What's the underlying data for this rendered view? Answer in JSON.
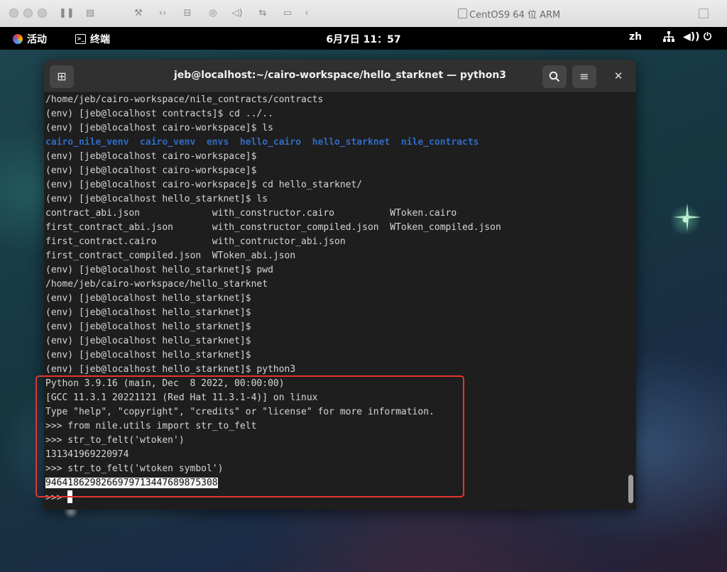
{
  "mac_window": {
    "title": "CentOS9 64 位 ARM",
    "toolbar_icons": [
      "pause-icon",
      "snapshot-icon",
      "settings-wrench-icon",
      "code-icon",
      "disk-icon",
      "camera-icon",
      "volume-icon",
      "usb-icon",
      "folder-share-icon",
      "back-chevron-icon"
    ]
  },
  "gnome_panel": {
    "activities": "活动",
    "app_name": "终端",
    "clock": "6月7日  11：57",
    "input_method": "zh",
    "tray_icons": [
      "network-icon",
      "volume-icon",
      "power-icon"
    ]
  },
  "terminal": {
    "title": "jeb@localhost:~/cairo-workspace/hello_starknet — python3",
    "new_tab_icon": "new-tab-icon",
    "search_icon": "search-icon",
    "menu_icon": "hamburger-menu-icon",
    "close_icon": "close-icon",
    "lines": [
      {
        "text": "/home/jeb/cairo-workspace/nile_contracts/contracts"
      },
      {
        "text": "(env) [jeb@localhost contracts]$ cd ../.."
      },
      {
        "text": "(env) [jeb@localhost cairo-workspace]$ ls"
      },
      {
        "text": "cairo_nile_venv  cairo_venv  envs  hello_cairo  hello_starknet  nile_contracts",
        "style": "dir"
      },
      {
        "text": "(env) [jeb@localhost cairo-workspace]$"
      },
      {
        "text": "(env) [jeb@localhost cairo-workspace]$"
      },
      {
        "text": "(env) [jeb@localhost cairo-workspace]$ cd hello_starknet/"
      },
      {
        "text": "(env) [jeb@localhost hello_starknet]$ ls"
      },
      {
        "text": "contract_abi.json             with_constructor.cairo          WToken.cairo"
      },
      {
        "text": "first_contract_abi.json       with_constructor_compiled.json  WToken_compiled.json"
      },
      {
        "text": "first_contract.cairo          with_contructor_abi.json"
      },
      {
        "text": "first_contract_compiled.json  WToken_abi.json"
      },
      {
        "text": "(env) [jeb@localhost hello_starknet]$ pwd"
      },
      {
        "text": "/home/jeb/cairo-workspace/hello_starknet"
      },
      {
        "text": "(env) [jeb@localhost hello_starknet]$"
      },
      {
        "text": "(env) [jeb@localhost hello_starknet]$"
      },
      {
        "text": "(env) [jeb@localhost hello_starknet]$"
      },
      {
        "text": "(env) [jeb@localhost hello_starknet]$"
      },
      {
        "text": "(env) [jeb@localhost hello_starknet]$"
      },
      {
        "text": "(env) [jeb@localhost hello_starknet]$ python3"
      },
      {
        "text": "Python 3.9.16 (main, Dec  8 2022, 00:00:00)"
      },
      {
        "text": "[GCC 11.3.1 20221121 (Red Hat 11.3.1-4)] on linux"
      },
      {
        "text": "Type \"help\", \"copyright\", \"credits\" or \"license\" for more information."
      },
      {
        "text": ">>> from nile.utils import str_to_felt"
      },
      {
        "text": ">>> str_to_felt('wtoken')"
      },
      {
        "text": "131341969220974"
      },
      {
        "text": ">>> str_to_felt('wtoken symbol')"
      },
      {
        "text": "9464186298266979713447689875308",
        "style": "selected"
      },
      {
        "text": ">>> ",
        "style": "prompt-cursor"
      }
    ]
  },
  "colors": {
    "annotation_border": "#e3342f",
    "directory_blue": "#2f6bc4"
  }
}
